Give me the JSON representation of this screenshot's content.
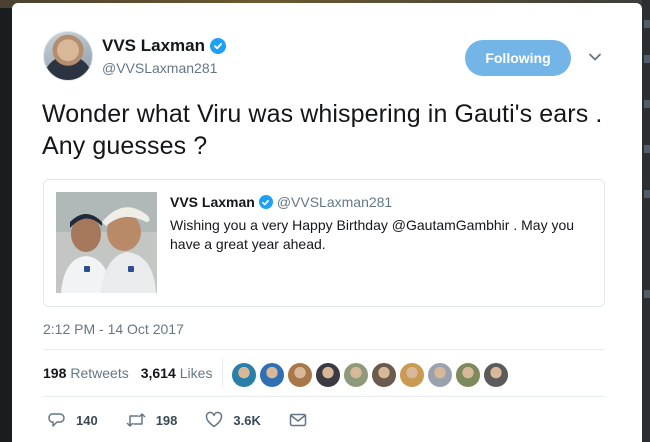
{
  "tweet": {
    "author_name": "VVS Laxman",
    "author_handle": "@VVSLaxman281",
    "follow_label": "Following",
    "text": "Wonder what Viru was whispering in Gauti's ears . Any guesses ?",
    "timestamp": "2:12 PM - 14 Oct 2017",
    "retweets": "198",
    "retweets_label": "Retweets",
    "likes": "3,614",
    "likes_label": "Likes"
  },
  "quote": {
    "author_name": "VVS Laxman",
    "author_handle": "@VVSLaxman281",
    "text": "Wishing you a very Happy Birthday @GautamGambhir . May  you have a great year ahead."
  },
  "actions": {
    "reply_count": "140",
    "retweet_count": "198",
    "like_count": "3.6K"
  },
  "likers": [
    {
      "color": "#2a7fa8"
    },
    {
      "color": "#2f6fb5"
    },
    {
      "color": "#a8774a"
    },
    {
      "color": "#3b3b44"
    },
    {
      "color": "#8f9a7a"
    },
    {
      "color": "#6b5a4e"
    },
    {
      "color": "#c89a52"
    },
    {
      "color": "#9aa3ad"
    },
    {
      "color": "#7c8a5c"
    },
    {
      "color": "#5b5b5b"
    }
  ],
  "colors": {
    "accent": "#1da1f2",
    "follow_button": "#74b5e8",
    "text": "#14171a",
    "muted": "#657786"
  },
  "icons": [
    "verified-badge-icon",
    "chevron-down-icon",
    "reply-icon",
    "retweet-icon",
    "like-icon",
    "dm-icon"
  ]
}
